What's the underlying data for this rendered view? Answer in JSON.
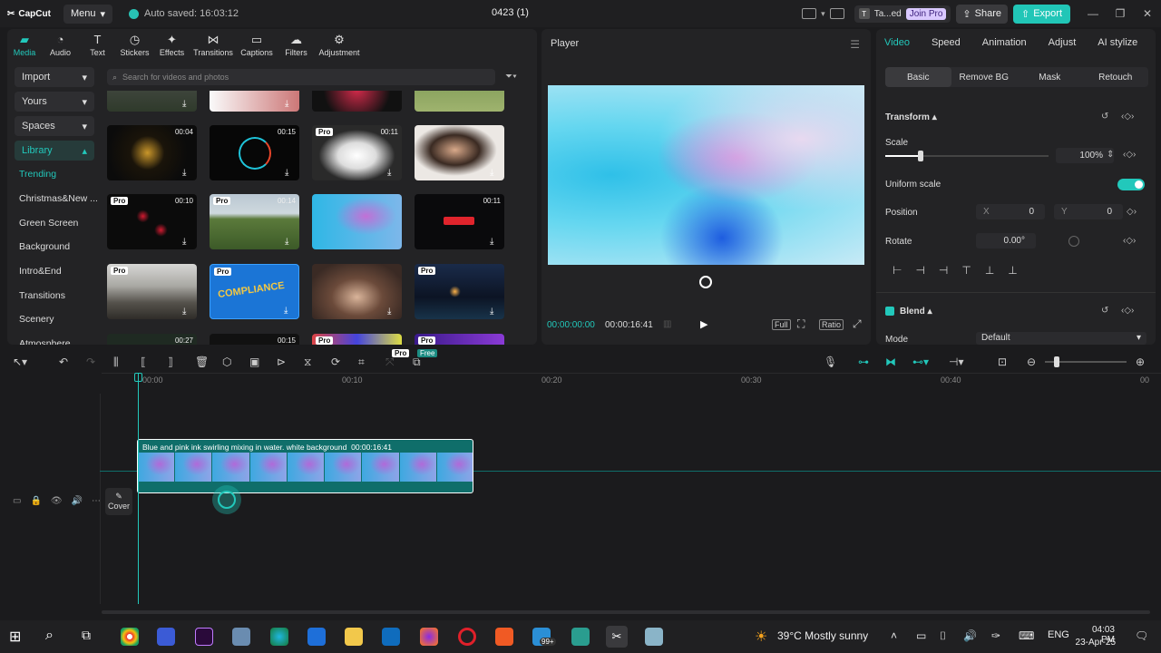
{
  "titlebar": {
    "app_name": "CapCut",
    "menu_label": "Menu",
    "autosave_text": "Auto saved: 16:03:12",
    "project_name": "0423 (1)",
    "user_initial": "T",
    "user_name": "Ta...ed",
    "join_pro": "Join Pro",
    "share": "Share",
    "export": "Export"
  },
  "media_tabs": [
    {
      "label": "Media",
      "icon": "media-icon"
    },
    {
      "label": "Audio",
      "icon": "audio-icon"
    },
    {
      "label": "Text",
      "icon": "text-icon"
    },
    {
      "label": "Stickers",
      "icon": "stickers-icon"
    },
    {
      "label": "Effects",
      "icon": "effects-icon"
    },
    {
      "label": "Transitions",
      "icon": "transitions-icon"
    },
    {
      "label": "Captions",
      "icon": "captions-icon"
    },
    {
      "label": "Filters",
      "icon": "filters-icon"
    },
    {
      "label": "Adjustment",
      "icon": "adjustment-icon"
    }
  ],
  "left_nav": {
    "import": "Import",
    "yours": "Yours",
    "spaces": "Spaces",
    "library": "Library",
    "items": [
      "Trending",
      "Christmas&New ...",
      "Green Screen",
      "Background",
      "Intro&End",
      "Transitions",
      "Scenery",
      "Atmosphere"
    ]
  },
  "search_placeholder": "Search for videos and photos",
  "grid": {
    "row1_durations": [
      "00:04",
      "00:15",
      "00:11",
      ""
    ],
    "row2_durations": [
      "00:10",
      "00:14",
      "",
      "00:11"
    ],
    "row4_durations": [
      "00:27",
      "00:15",
      "",
      ""
    ],
    "pro_label": "Pro",
    "free_label": "Free",
    "compliance_text": "COMPLIANCE"
  },
  "player": {
    "title": "Player",
    "current_time": "00:00:00:00",
    "total_time": "00:00:16:41",
    "full": "Full",
    "ratio": "Ratio"
  },
  "right_panel": {
    "tabs": [
      "Video",
      "Speed",
      "Animation",
      "Adjust",
      "AI stylize"
    ],
    "subtabs": [
      "Basic",
      "Remove BG",
      "Mask",
      "Retouch"
    ],
    "transform": "Transform",
    "scale_label": "Scale",
    "scale_value": "100%",
    "scale_fraction": 0.2,
    "uniform_scale": "Uniform scale",
    "position_label": "Position",
    "pos_x_label": "X",
    "pos_x": "0",
    "pos_y_label": "Y",
    "pos_y": "0",
    "rotate_label": "Rotate",
    "rotate_value": "0.00°",
    "blend": "Blend",
    "mode_label": "Mode",
    "mode_value": "Default"
  },
  "timeline": {
    "ruler": [
      "00:00",
      "00:10",
      "00:20",
      "00:30",
      "00:40"
    ],
    "clip_title": "Blue and pink ink swirling mixing in water. white background",
    "clip_duration": "00:00:16:41",
    "cover_label": "Cover"
  },
  "taskbar": {
    "weather": "39°C  Mostly sunny",
    "lang": "ENG",
    "time": "04:03 PM",
    "date": "23-Apr-25",
    "badge": "99+"
  },
  "colors": {
    "accent": "#22c8bb",
    "bg": "#1b1b1d",
    "panel": "#232325"
  }
}
